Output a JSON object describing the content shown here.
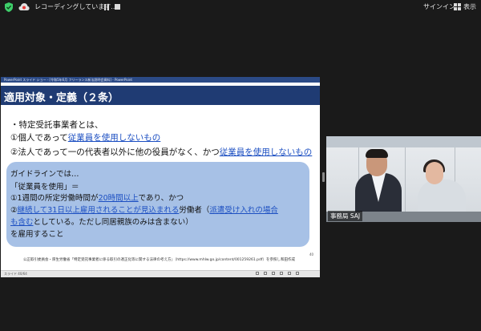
{
  "topbar": {
    "recording_label": "レコーディングしています...",
    "signin_label": "サインイン",
    "view_label": "表示"
  },
  "shared_screen": {
    "ppt_window_title": "PowerPoint スライド ショー - [令和5年6月 フリーランス新法説明会資料] - PowerPoint",
    "slide": {
      "title": "適用対象・定義（２条）",
      "bullet": "・特定受託事業者とは、",
      "item1_prefix": "①個人であって",
      "item1_emph": "従業員を使用しないもの",
      "item2_prefix": "②法人であって一の代表者以外に他の役員がなく、かつ",
      "item2_emph": "従業員を使用しないもの",
      "guide": {
        "l1": "ガイドラインでは…",
        "l2": "「従業員を使用」＝",
        "l3_prefix": "①1週間の所定労働時間が",
        "l3_emph": "20時間以上",
        "l3_suffix": "であり、かつ",
        "l4_prefix": "②",
        "l4_emph": "継続して31日以上雇用されることが見込まれる",
        "l4_mid": "労働者（",
        "l4_emph2": "派遣受け入れの場合",
        "l5_emph": "も含む",
        "l5_suffix": "としている。ただし同居親族のみは含まない）",
        "l6": "を雇用すること"
      },
      "page_number": "40",
      "footnote": "公正取引委員会・厚生労働省「特定受託事業者に係る取引の適正化等に関する法律の考え方」（https://www.mhlw.go.jp/content/001259261.pdf）を参照し和田作成"
    },
    "status_text": "スライド 40/64"
  },
  "video": {
    "participant_name": "事務局 SAJ"
  },
  "colors": {
    "slide_header": "#1f3b73",
    "highlight_text": "#1c4fc2",
    "guide_box": "#a7c1e6",
    "shield": "#3ecf6a"
  }
}
